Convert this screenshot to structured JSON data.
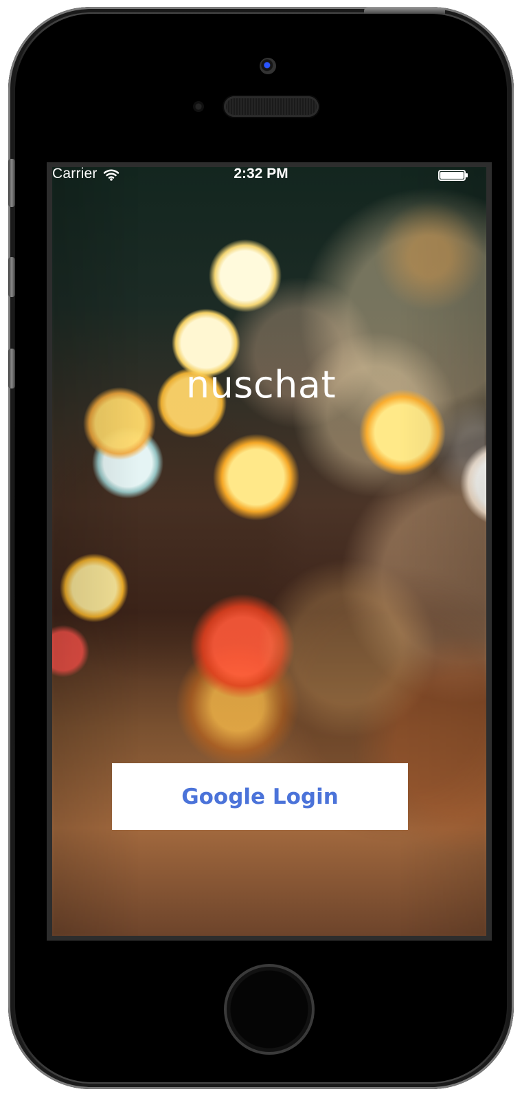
{
  "status_bar": {
    "carrier": "Carrier",
    "time": "2:32 PM",
    "icons": {
      "wifi": "wifi-icon",
      "battery": "battery-icon"
    }
  },
  "app": {
    "title": "nuschat",
    "login_button": "Google Login",
    "accent_color": "#4b73d9"
  }
}
